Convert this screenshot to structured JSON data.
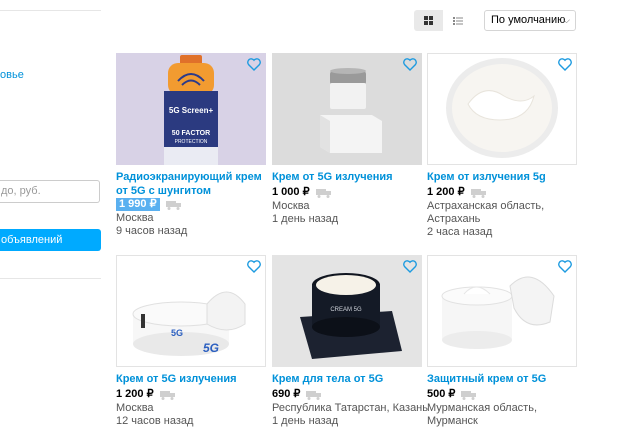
{
  "sidebar": {
    "link_fragment": "овье",
    "price_placeholder": "до, руб.",
    "show_button": "объявлений"
  },
  "toolbar": {
    "grid_icon": "grid-view-icon",
    "list_icon": "list-view-icon",
    "sort_label": "По умолчанию"
  },
  "colors": {
    "link": "#0091d9",
    "button": "#00aaff",
    "price_highlight": "#5ab0f0"
  },
  "items": [
    {
      "title": "Радиоэкранирующий крем от 5G с шунгитом",
      "price": "1 990 ₽",
      "location": "Москва",
      "time": "9 часов назад",
      "highlighted": true,
      "product_label": [
        "5G Screen+",
        "50 FACTOR",
        "PROTECTION"
      ]
    },
    {
      "title": "Крем от 5G излучения",
      "price": "1 000 ₽",
      "location": "Москва",
      "time": "1 день назад",
      "highlighted": false
    },
    {
      "title": "Крем от излучения 5g",
      "price": "1 200 ₽",
      "location": "Астраханская область, Астрахань",
      "time": "2 часа назад",
      "highlighted": false
    },
    {
      "title": "Крем от 5G излучения",
      "price": "1 200 ₽",
      "location": "Москва",
      "time": "12 часов назад",
      "highlighted": false,
      "product_label": [
        "5G",
        "5G"
      ]
    },
    {
      "title": "Крем для тела от 5G",
      "price": "690 ₽",
      "location": "Республика Татарстан, Казань",
      "time": "1 день назад",
      "highlighted": false,
      "product_label": [
        "CREAM 5G"
      ]
    },
    {
      "title": "Защитный крем от 5G",
      "price": "500 ₽",
      "location": "Мурманская область, Мурманск",
      "time": "",
      "highlighted": false
    }
  ]
}
